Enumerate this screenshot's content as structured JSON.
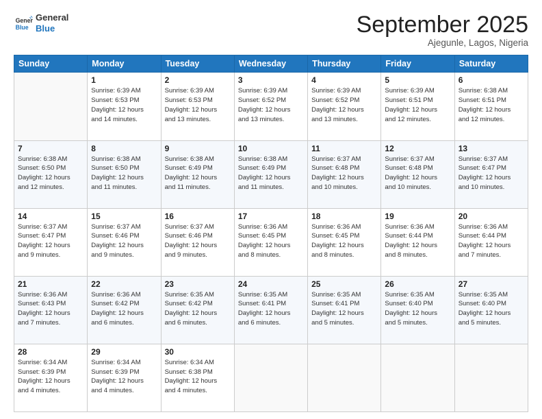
{
  "logo": {
    "line1": "General",
    "line2": "Blue"
  },
  "title": "September 2025",
  "location": "Ajegunle, Lagos, Nigeria",
  "headers": [
    "Sunday",
    "Monday",
    "Tuesday",
    "Wednesday",
    "Thursday",
    "Friday",
    "Saturday"
  ],
  "weeks": [
    [
      {
        "num": "",
        "info": ""
      },
      {
        "num": "1",
        "info": "Sunrise: 6:39 AM\nSunset: 6:53 PM\nDaylight: 12 hours\nand 14 minutes."
      },
      {
        "num": "2",
        "info": "Sunrise: 6:39 AM\nSunset: 6:53 PM\nDaylight: 12 hours\nand 13 minutes."
      },
      {
        "num": "3",
        "info": "Sunrise: 6:39 AM\nSunset: 6:52 PM\nDaylight: 12 hours\nand 13 minutes."
      },
      {
        "num": "4",
        "info": "Sunrise: 6:39 AM\nSunset: 6:52 PM\nDaylight: 12 hours\nand 13 minutes."
      },
      {
        "num": "5",
        "info": "Sunrise: 6:39 AM\nSunset: 6:51 PM\nDaylight: 12 hours\nand 12 minutes."
      },
      {
        "num": "6",
        "info": "Sunrise: 6:38 AM\nSunset: 6:51 PM\nDaylight: 12 hours\nand 12 minutes."
      }
    ],
    [
      {
        "num": "7",
        "info": "Sunrise: 6:38 AM\nSunset: 6:50 PM\nDaylight: 12 hours\nand 12 minutes."
      },
      {
        "num": "8",
        "info": "Sunrise: 6:38 AM\nSunset: 6:50 PM\nDaylight: 12 hours\nand 11 minutes."
      },
      {
        "num": "9",
        "info": "Sunrise: 6:38 AM\nSunset: 6:49 PM\nDaylight: 12 hours\nand 11 minutes."
      },
      {
        "num": "10",
        "info": "Sunrise: 6:38 AM\nSunset: 6:49 PM\nDaylight: 12 hours\nand 11 minutes."
      },
      {
        "num": "11",
        "info": "Sunrise: 6:37 AM\nSunset: 6:48 PM\nDaylight: 12 hours\nand 10 minutes."
      },
      {
        "num": "12",
        "info": "Sunrise: 6:37 AM\nSunset: 6:48 PM\nDaylight: 12 hours\nand 10 minutes."
      },
      {
        "num": "13",
        "info": "Sunrise: 6:37 AM\nSunset: 6:47 PM\nDaylight: 12 hours\nand 10 minutes."
      }
    ],
    [
      {
        "num": "14",
        "info": "Sunrise: 6:37 AM\nSunset: 6:47 PM\nDaylight: 12 hours\nand 9 minutes."
      },
      {
        "num": "15",
        "info": "Sunrise: 6:37 AM\nSunset: 6:46 PM\nDaylight: 12 hours\nand 9 minutes."
      },
      {
        "num": "16",
        "info": "Sunrise: 6:37 AM\nSunset: 6:46 PM\nDaylight: 12 hours\nand 9 minutes."
      },
      {
        "num": "17",
        "info": "Sunrise: 6:36 AM\nSunset: 6:45 PM\nDaylight: 12 hours\nand 8 minutes."
      },
      {
        "num": "18",
        "info": "Sunrise: 6:36 AM\nSunset: 6:45 PM\nDaylight: 12 hours\nand 8 minutes."
      },
      {
        "num": "19",
        "info": "Sunrise: 6:36 AM\nSunset: 6:44 PM\nDaylight: 12 hours\nand 8 minutes."
      },
      {
        "num": "20",
        "info": "Sunrise: 6:36 AM\nSunset: 6:44 PM\nDaylight: 12 hours\nand 7 minutes."
      }
    ],
    [
      {
        "num": "21",
        "info": "Sunrise: 6:36 AM\nSunset: 6:43 PM\nDaylight: 12 hours\nand 7 minutes."
      },
      {
        "num": "22",
        "info": "Sunrise: 6:36 AM\nSunset: 6:42 PM\nDaylight: 12 hours\nand 6 minutes."
      },
      {
        "num": "23",
        "info": "Sunrise: 6:35 AM\nSunset: 6:42 PM\nDaylight: 12 hours\nand 6 minutes."
      },
      {
        "num": "24",
        "info": "Sunrise: 6:35 AM\nSunset: 6:41 PM\nDaylight: 12 hours\nand 6 minutes."
      },
      {
        "num": "25",
        "info": "Sunrise: 6:35 AM\nSunset: 6:41 PM\nDaylight: 12 hours\nand 5 minutes."
      },
      {
        "num": "26",
        "info": "Sunrise: 6:35 AM\nSunset: 6:40 PM\nDaylight: 12 hours\nand 5 minutes."
      },
      {
        "num": "27",
        "info": "Sunrise: 6:35 AM\nSunset: 6:40 PM\nDaylight: 12 hours\nand 5 minutes."
      }
    ],
    [
      {
        "num": "28",
        "info": "Sunrise: 6:34 AM\nSunset: 6:39 PM\nDaylight: 12 hours\nand 4 minutes."
      },
      {
        "num": "29",
        "info": "Sunrise: 6:34 AM\nSunset: 6:39 PM\nDaylight: 12 hours\nand 4 minutes."
      },
      {
        "num": "30",
        "info": "Sunrise: 6:34 AM\nSunset: 6:38 PM\nDaylight: 12 hours\nand 4 minutes."
      },
      {
        "num": "",
        "info": ""
      },
      {
        "num": "",
        "info": ""
      },
      {
        "num": "",
        "info": ""
      },
      {
        "num": "",
        "info": ""
      }
    ]
  ]
}
